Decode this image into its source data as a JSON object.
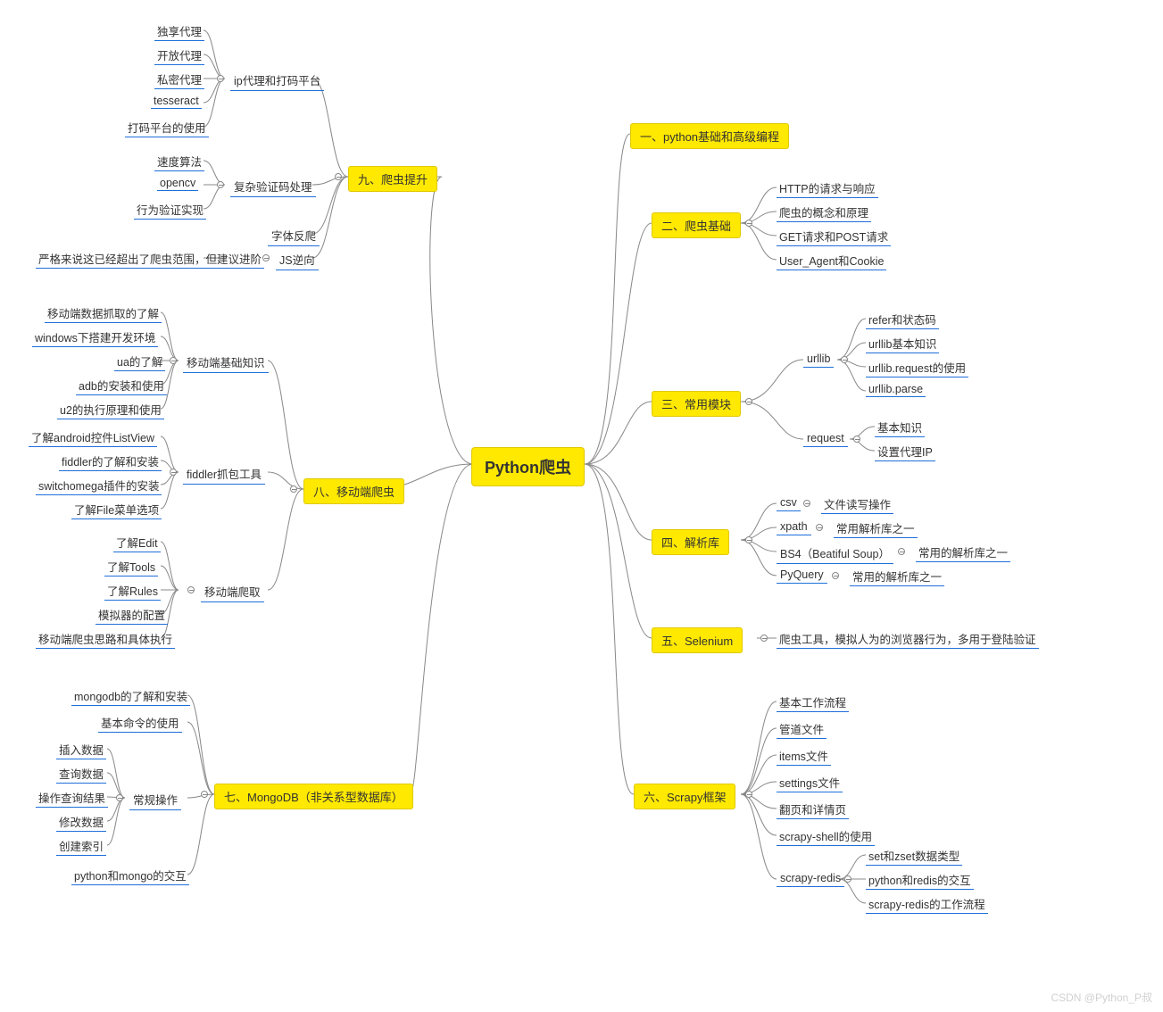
{
  "center": "Python爬虫",
  "watermark": "CSDN @Python_P叔",
  "b1": {
    "title": "一、python基础和高级编程"
  },
  "b2": {
    "title": "二、爬虫基础",
    "items": [
      "HTTP的请求与响应",
      "爬虫的概念和原理",
      "GET请求和POST请求",
      "User_Agent和Cookie"
    ]
  },
  "b3": {
    "title": "三、常用模块",
    "urllib": {
      "name": "urllib",
      "items": [
        "refer和状态码",
        "urllib基本知识",
        "urllib.request的使用",
        "urllib.parse"
      ]
    },
    "request": {
      "name": "request",
      "items": [
        "基本知识",
        "设置代理IP"
      ]
    }
  },
  "b4": {
    "title": "四、解析库",
    "rows": [
      {
        "k": "csv",
        "v": "文件读写操作"
      },
      {
        "k": "xpath",
        "v": "常用解析库之一"
      },
      {
        "k": "BS4（Beatiful Soup）",
        "v": "常用的解析库之一"
      },
      {
        "k": "PyQuery",
        "v": "常用的解析库之一"
      }
    ]
  },
  "b5": {
    "title": "五、Selenium",
    "desc": "爬虫工具，模拟人为的浏览器行为，多用于登陆验证"
  },
  "b6": {
    "title": "六、Scrapy框架",
    "items": [
      "基本工作流程",
      "管道文件",
      "items文件",
      "settings文件",
      "翻页和详情页",
      "scrapy-shell的使用"
    ],
    "redis": {
      "name": "scrapy-redis",
      "items": [
        "set和zset数据类型",
        "python和redis的交互",
        "scrapy-redis的工作流程"
      ]
    }
  },
  "b7": {
    "title": "七、MongoDB（非关系型数据库）",
    "top": [
      "mongodb的了解和安装",
      "基本命令的使用"
    ],
    "ops": {
      "name": "常规操作",
      "items": [
        "插入数据",
        "查询数据",
        "操作查询结果",
        "修改数据",
        "创建索引"
      ]
    },
    "bottom": [
      "python和mongo的交互"
    ]
  },
  "b8": {
    "title": "八、移动端爬虫",
    "g1": {
      "name": "移动端基础知识",
      "items": [
        "移动端数据抓取的了解",
        "windows下搭建开发环境",
        "ua的了解",
        "adb的安装和使用",
        "u2的执行原理和使用"
      ]
    },
    "g2": {
      "name": "fiddler抓包工具",
      "items": [
        "了解android控件ListView",
        "fiddler的了解和安装",
        "switchomega插件的安装",
        "了解File菜单选项"
      ]
    },
    "g3": {
      "name": "移动端爬取",
      "items": [
        "了解Edit",
        "了解Tools",
        "了解Rules",
        "模拟器的配置",
        "移动端爬虫思路和具体执行"
      ]
    }
  },
  "b9": {
    "title": "九、爬虫提升",
    "g1": {
      "name": "ip代理和打码平台",
      "items": [
        "独享代理",
        "开放代理",
        "私密代理",
        "tesseract",
        "打码平台的使用"
      ]
    },
    "g2": {
      "name": "复杂验证码处理",
      "items": [
        "速度算法",
        "opencv",
        "行为验证实现"
      ]
    },
    "g3": {
      "name": "字体反爬"
    },
    "g4": {
      "name": "JS逆向",
      "note": "严格来说这已经超出了爬虫范围，但建议进阶"
    }
  }
}
